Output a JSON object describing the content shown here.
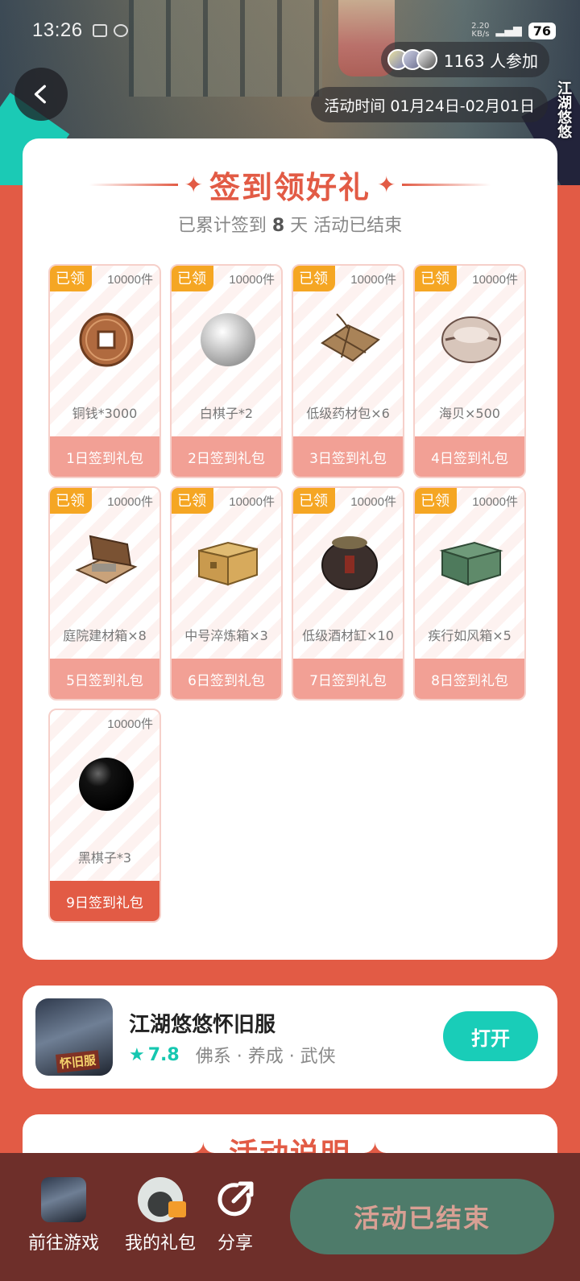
{
  "status_bar": {
    "time": "13:26",
    "net_speed": "2.20",
    "net_unit": "KB/s",
    "battery": "76"
  },
  "banner": {
    "participants_count": "1163 人参加",
    "activity_period": "活动时间 01月24日-02月01日",
    "logo_text": "江湖悠悠"
  },
  "signin": {
    "title": "签到领好礼",
    "summary_prefix": "已累计签到",
    "summary_days": "8",
    "summary_suffix": "天  活动已结束",
    "gifts": [
      {
        "claimed_label": "已领",
        "stock": "10000件",
        "name": "铜钱*3000",
        "day_label": "1日签到礼包",
        "icon": "copper-coin-icon"
      },
      {
        "claimed_label": "已领",
        "stock": "10000件",
        "name": "白棋子*2",
        "day_label": "2日签到礼包",
        "icon": "white-go-stone-icon"
      },
      {
        "claimed_label": "已领",
        "stock": "10000件",
        "name": "低级药材包×6",
        "day_label": "3日签到礼包",
        "icon": "herb-package-icon"
      },
      {
        "claimed_label": "已领",
        "stock": "10000件",
        "name": "海贝×500",
        "day_label": "4日签到礼包",
        "icon": "seashell-icon"
      },
      {
        "claimed_label": "已领",
        "stock": "10000件",
        "name": "庭院建材箱×8",
        "day_label": "5日签到礼包",
        "icon": "open-crate-icon"
      },
      {
        "claimed_label": "已领",
        "stock": "10000件",
        "name": "中号淬炼箱×3",
        "day_label": "6日签到礼包",
        "icon": "wooden-chest-icon"
      },
      {
        "claimed_label": "已领",
        "stock": "10000件",
        "name": "低级酒材缸×10",
        "day_label": "7日签到礼包",
        "icon": "wine-jar-icon"
      },
      {
        "claimed_label": "已领",
        "stock": "10000件",
        "name": "疾行如风箱×5",
        "day_label": "8日签到礼包",
        "icon": "green-box-icon"
      },
      {
        "claimed_label": "",
        "stock": "10000件",
        "name": "黑棋子*3",
        "day_label": "9日签到礼包",
        "icon": "black-go-stone-icon"
      }
    ]
  },
  "app": {
    "name": "江湖悠悠怀旧服",
    "icon_tag": "怀旧服",
    "rating": "7.8",
    "tags": "佛系 · 养成 · 武侠",
    "open_label": "打开"
  },
  "rules": {
    "title": "活动说明"
  },
  "bottom_bar": {
    "go_game_label": "前往游戏",
    "my_gifts_label": "我的礼包",
    "share_label": "分享",
    "end_button_label": "活动已结束"
  },
  "colors": {
    "page_bg": "#E25B45",
    "claimed_badge": "#F5A623",
    "day_bar": "#F2A095",
    "accent_teal": "#19CDB8",
    "bottom_bar": "#6E2F2A",
    "end_button": "#4E7B6A"
  }
}
